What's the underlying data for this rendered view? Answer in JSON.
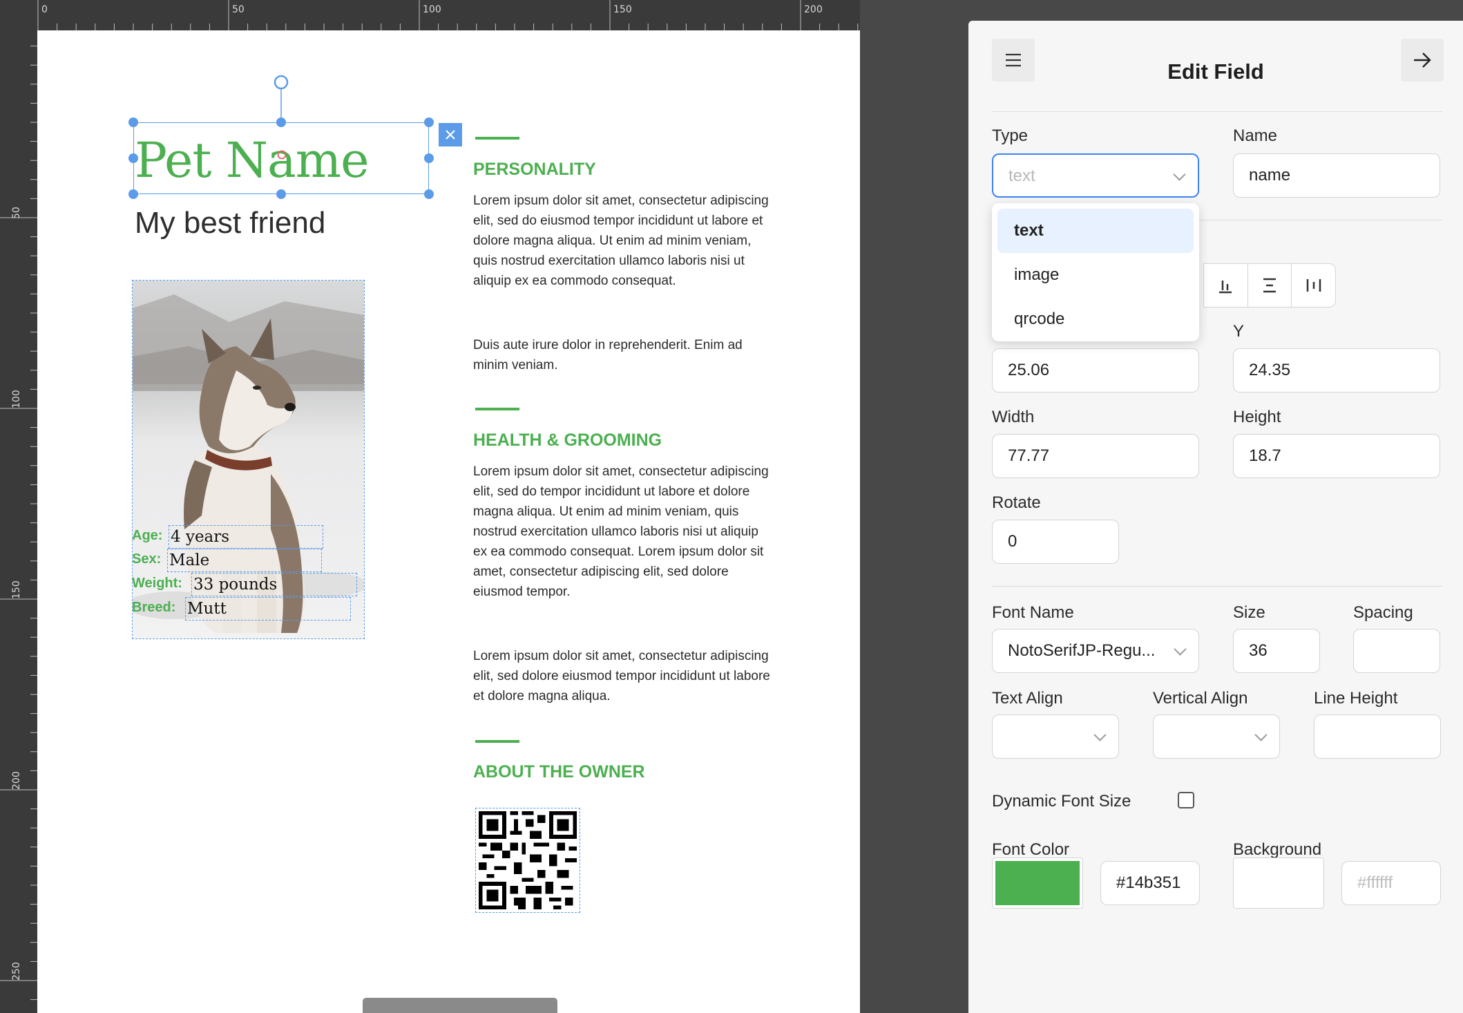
{
  "ruler": {
    "top_labels": [
      "0",
      "50",
      "100",
      "150",
      "200"
    ],
    "left_labels": [
      "50",
      "100",
      "150",
      "200",
      "250"
    ]
  },
  "canvas": {
    "pet_name": "Pet Name",
    "subtitle": "My best friend",
    "info": [
      {
        "label": "Age:",
        "value": "4 years"
      },
      {
        "label": "Sex:",
        "value": "Male"
      },
      {
        "label": "Weight:",
        "value": "33 pounds"
      },
      {
        "label": "Breed:",
        "value": "Mutt"
      }
    ],
    "sections": [
      {
        "heading": "PERSONALITY",
        "paragraphs": [
          "Lorem ipsum dolor sit amet, consectetur adipiscing elit, sed do eiusmod tempor incididunt ut labore et dolore magna aliqua. Ut enim ad minim veniam, quis nostrud exercitation ullamco laboris nisi ut aliquip ex ea commodo consequat.",
          "Duis aute irure dolor in reprehenderit. Enim ad minim veniam."
        ]
      },
      {
        "heading": "HEALTH & GROOMING",
        "paragraphs": [
          "Lorem ipsum dolor sit amet, consectetur adipiscing elit, sed do tempor incididunt ut labore et dolore magna aliqua. Ut enim ad minim veniam, quis nostrud exercitation ullamco laboris nisi ut aliquip ex ea commodo consequat. Lorem ipsum dolor sit amet, consectetur adipiscing elit, sed dolore eiusmod tempor.",
          "Lorem ipsum dolor sit amet, consectetur adipiscing elit, sed dolore eiusmod tempor incididunt ut labore et dolore magna aliqua."
        ]
      },
      {
        "heading": "ABOUT THE OWNER",
        "paragraphs": []
      }
    ],
    "accent_color": "#4caf50",
    "selection_color": "#5b9be8"
  },
  "panel": {
    "title": "Edit Field",
    "menu_icon": "hamburger-icon",
    "close_icon": "arrow-right-icon",
    "type_label": "Type",
    "type_value": "text",
    "type_options": [
      "text",
      "image",
      "qrcode"
    ],
    "name_label": "Name",
    "name_value": "name",
    "y_label": "Y",
    "x_value": "25.06",
    "y_value": "24.35",
    "width_label": "Width",
    "width_value": "77.77",
    "height_label": "Height",
    "height_value": "18.7",
    "rotate_label": "Rotate",
    "rotate_value": "0",
    "font_name_label": "Font Name",
    "font_name_value": "NotoSerifJP-Regu...",
    "size_label": "Size",
    "size_value": "36",
    "spacing_label": "Spacing",
    "spacing_value": "",
    "text_align_label": "Text Align",
    "vertical_align_label": "Vertical Align",
    "line_height_label": "Line Height",
    "dynamic_font_label": "Dynamic Font Size",
    "dynamic_font_checked": false,
    "font_color_label": "Font Color",
    "font_color_value": "#14b351",
    "background_label": "Background",
    "background_placeholder": "#ffffff"
  }
}
